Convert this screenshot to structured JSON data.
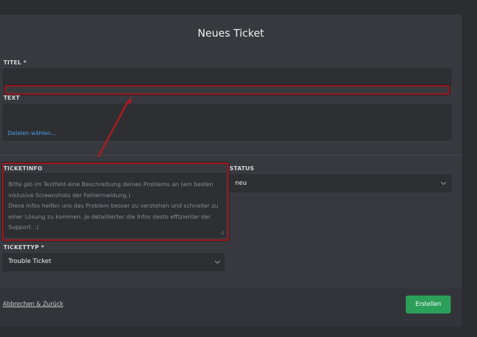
{
  "form": {
    "title": "Neues Ticket",
    "titel_label": "TITEL *",
    "titel_value": "",
    "text_label": "TEXT",
    "text_value": "",
    "file_link": "Dateien wählen...",
    "ticketinfo_label": "TICKETINFO",
    "ticketinfo_placeholder": "Bitte gib im Textfeld eine Beschreibung deines Problems an (am besten\ninklusive Screenshots der Fehlermeldung.)\nDiese Infos helfen uns das Problem besser zu verstehen und schneller zu\neiner Lösung zu kommen. Je detaillierter die Infos desto effizienter der\nSupport. :)",
    "status_label": "STATUS",
    "status_value": "neu",
    "tickettyp_label": "TICKETTYP *",
    "tickettyp_value": "Trouble Ticket"
  },
  "footer": {
    "cancel_label": "Abbrechen & Zurück",
    "create_label": "Erstellen"
  },
  "colors": {
    "accent_link": "#4a9ee6",
    "create_button": "#2c9f5a",
    "annotation_red": "#a3151b"
  },
  "icons": [
    "chevron-down-icon",
    "resize-grip-icon",
    "annotation-arrow"
  ]
}
